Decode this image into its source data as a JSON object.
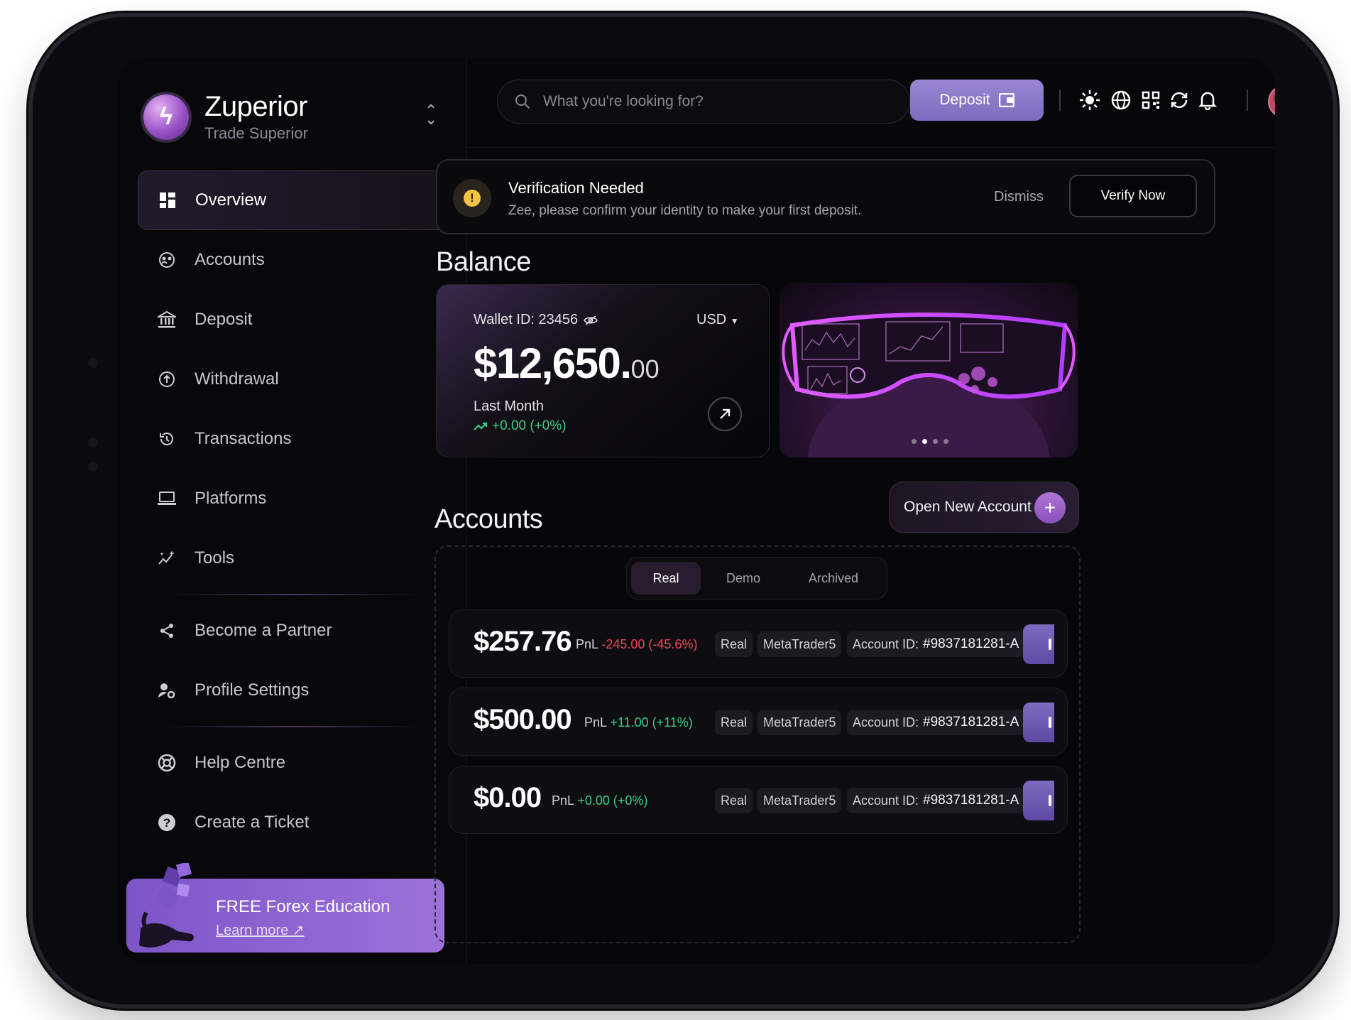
{
  "sidebar": {
    "brand_name": "Zuperior",
    "brand_tagline": "Trade Superior",
    "brand_logo_glyph": "ϟ",
    "items": [
      {
        "label": "Overview",
        "icon": "dashboard-icon",
        "active": true
      },
      {
        "label": "Accounts",
        "icon": "accounts-icon"
      },
      {
        "label": "Deposit",
        "icon": "bank-icon"
      },
      {
        "label": "Withdrawal",
        "icon": "withdraw-icon"
      },
      {
        "label": "Transactions",
        "icon": "history-icon"
      },
      {
        "label": "Platforms",
        "icon": "laptop-icon"
      },
      {
        "label": "Tools",
        "icon": "sparkles-icon"
      },
      {
        "label": "Become a Partner",
        "icon": "share-icon"
      },
      {
        "label": "Profile Settings",
        "icon": "user-settings-icon"
      },
      {
        "label": "Help Centre",
        "icon": "lifebuoy-icon"
      },
      {
        "label": "Create a Ticket",
        "icon": "question-icon"
      }
    ],
    "promo": {
      "title": "FREE Forex Education",
      "link": "Learn more"
    }
  },
  "topbar": {
    "search_placeholder": "What you're looking for?",
    "deposit_label": "Deposit",
    "icons": [
      "sun-icon",
      "globe-icon",
      "qr-code-icon",
      "refresh-icon",
      "bell-icon"
    ]
  },
  "verification": {
    "title": "Verification Needed",
    "message": "Zee, please confirm your identity to make your first deposit.",
    "dismiss": "Dismiss",
    "action": "Verify Now"
  },
  "balance": {
    "section_title": "Balance",
    "wallet_id_label": "Wallet ID: 23456",
    "currency": "USD",
    "amount_whole": "$12,650.",
    "amount_cents": "00",
    "period_label": "Last Month",
    "change": "+0.00 (+0%)",
    "carousel": {
      "count": 4,
      "active_index": 1
    }
  },
  "accounts": {
    "section_title": "Accounts",
    "new_account_label": "Open New Account",
    "tabs": [
      "Real",
      "Demo",
      "Archived"
    ],
    "active_tab": "Real",
    "pnl_label": "PnL",
    "account_id_label": "Account ID:",
    "rows": [
      {
        "amount": "$257.76",
        "pnl": "-245.00 (-45.6%)",
        "pnl_sign": "neg",
        "type": "Real",
        "platform": "MetaTrader5",
        "account_id": "#9837181281-A"
      },
      {
        "amount": "$500.00",
        "pnl": "+11.00 (+11%)",
        "pnl_sign": "pos",
        "type": "Real",
        "platform": "MetaTrader5",
        "account_id": "#9837181281-A"
      },
      {
        "amount": "$0.00",
        "pnl": "+0.00 (+0%)",
        "pnl_sign": "pos",
        "type": "Real",
        "platform": "MetaTrader5",
        "account_id": "#9837181281-A"
      }
    ]
  },
  "colors": {
    "accent": "#8a4fbd",
    "deposit_button": "#8c79c9",
    "positive": "#37d086",
    "negative": "#f0475b",
    "background": "#07070a"
  }
}
